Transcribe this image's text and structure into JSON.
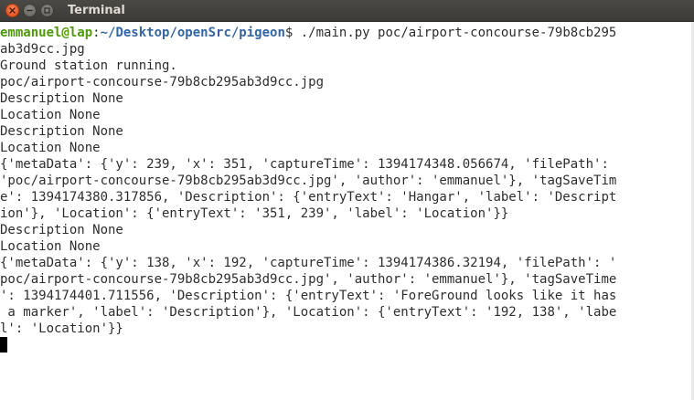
{
  "window": {
    "title": "Terminal",
    "icons": {
      "close": "close-icon",
      "minimize": "minimize-icon",
      "maximize": "maximize-icon"
    }
  },
  "terminal": {
    "prompt": {
      "user_host": "emmanuel@lap",
      "separator": ":",
      "path": "~/Desktop/openSrc/pigeon",
      "symbol": "$ ",
      "command": "./main.py poc/airport-concourse-79b8cb295"
    },
    "lines": [
      "ab3d9cc.jpg",
      "Ground station running.",
      "poc/airport-concourse-79b8cb295ab3d9cc.jpg",
      "Description None",
      "Location None",
      "Description None",
      "Location None",
      "{'metaData': {'y': 239, 'x': 351, 'captureTime': 1394174348.056674, 'filePath':",
      "'poc/airport-concourse-79b8cb295ab3d9cc.jpg', 'author': 'emmanuel'}, 'tagSaveTim",
      "e': 1394174380.317856, 'Description': {'entryText': 'Hangar', 'label': 'Descript",
      "ion'}, 'Location': {'entryText': '351, 239', 'label': 'Location'}}",
      "Description None",
      "Location None",
      "{'metaData': {'y': 138, 'x': 192, 'captureTime': 1394174386.32194, 'filePath': '",
      "poc/airport-concourse-79b8cb295ab3d9cc.jpg', 'author': 'emmanuel'}, 'tagSaveTime",
      "': 1394174401.711556, 'Description': {'entryText': 'ForeGround looks like it has",
      " a marker', 'label': 'Description'}, 'Location': {'entryText': '192, 138', 'labe",
      "l': 'Location'}}"
    ]
  },
  "colors": {
    "titlebar": "#3c3b37",
    "close_button": "#df4a16",
    "prompt_user": "#4e9a06",
    "prompt_path": "#3465a4",
    "text": "#2e2e2e",
    "background": "#ffffff"
  }
}
